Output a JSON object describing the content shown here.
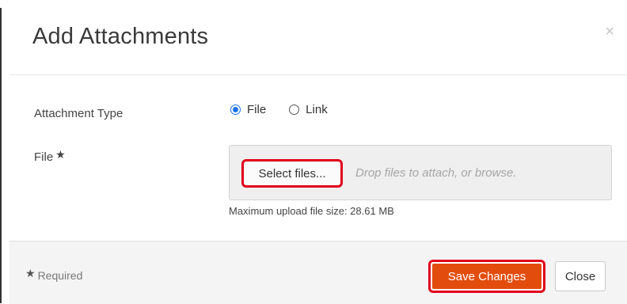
{
  "dialog": {
    "title": "Add Attachments",
    "close_glyph": "×"
  },
  "form": {
    "attachment_type_label": "Attachment Type",
    "type_options": [
      {
        "label": "File",
        "selected": true
      },
      {
        "label": "Link",
        "selected": false
      }
    ],
    "file_label": "File",
    "required_star": "★",
    "select_files_label": "Select files...",
    "drop_hint": "Drop files to attach, or browse.",
    "max_upload_text": "Maximum upload file size: 28.61 MB"
  },
  "footer": {
    "required_star": "★",
    "required_text": "Required",
    "save_label": "Save Changes",
    "close_label": "Close"
  },
  "colors": {
    "accent_orange": "#e24d0e",
    "highlight_red": "#e0001b",
    "radio_blue": "#1a73e8"
  },
  "icons": {
    "close": "close-icon",
    "required": "star-icon"
  }
}
